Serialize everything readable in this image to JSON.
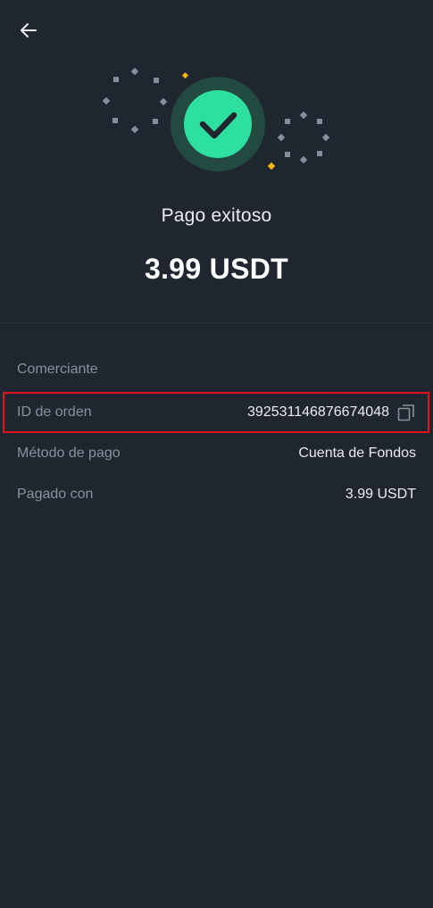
{
  "header": {
    "back_icon": "arrow-left-icon"
  },
  "status": {
    "icon": "check-circle-icon",
    "accent_color": "#2ee0a0",
    "title": "Pago exitoso",
    "amount": "3.99 USDT"
  },
  "details": {
    "merchant": {
      "label": "Comerciante",
      "value": ""
    },
    "order_id": {
      "label": "ID de orden",
      "value": "392531146876674048",
      "copy_icon": "copy-icon"
    },
    "payment_method": {
      "label": "Método de pago",
      "value": "Cuenta de Fondos"
    },
    "paid_with": {
      "label": "Pagado con",
      "value": "3.99 USDT"
    }
  },
  "colors": {
    "background": "#1f2630",
    "highlight_border": "#e0141e",
    "label_text": "#8a919c"
  }
}
